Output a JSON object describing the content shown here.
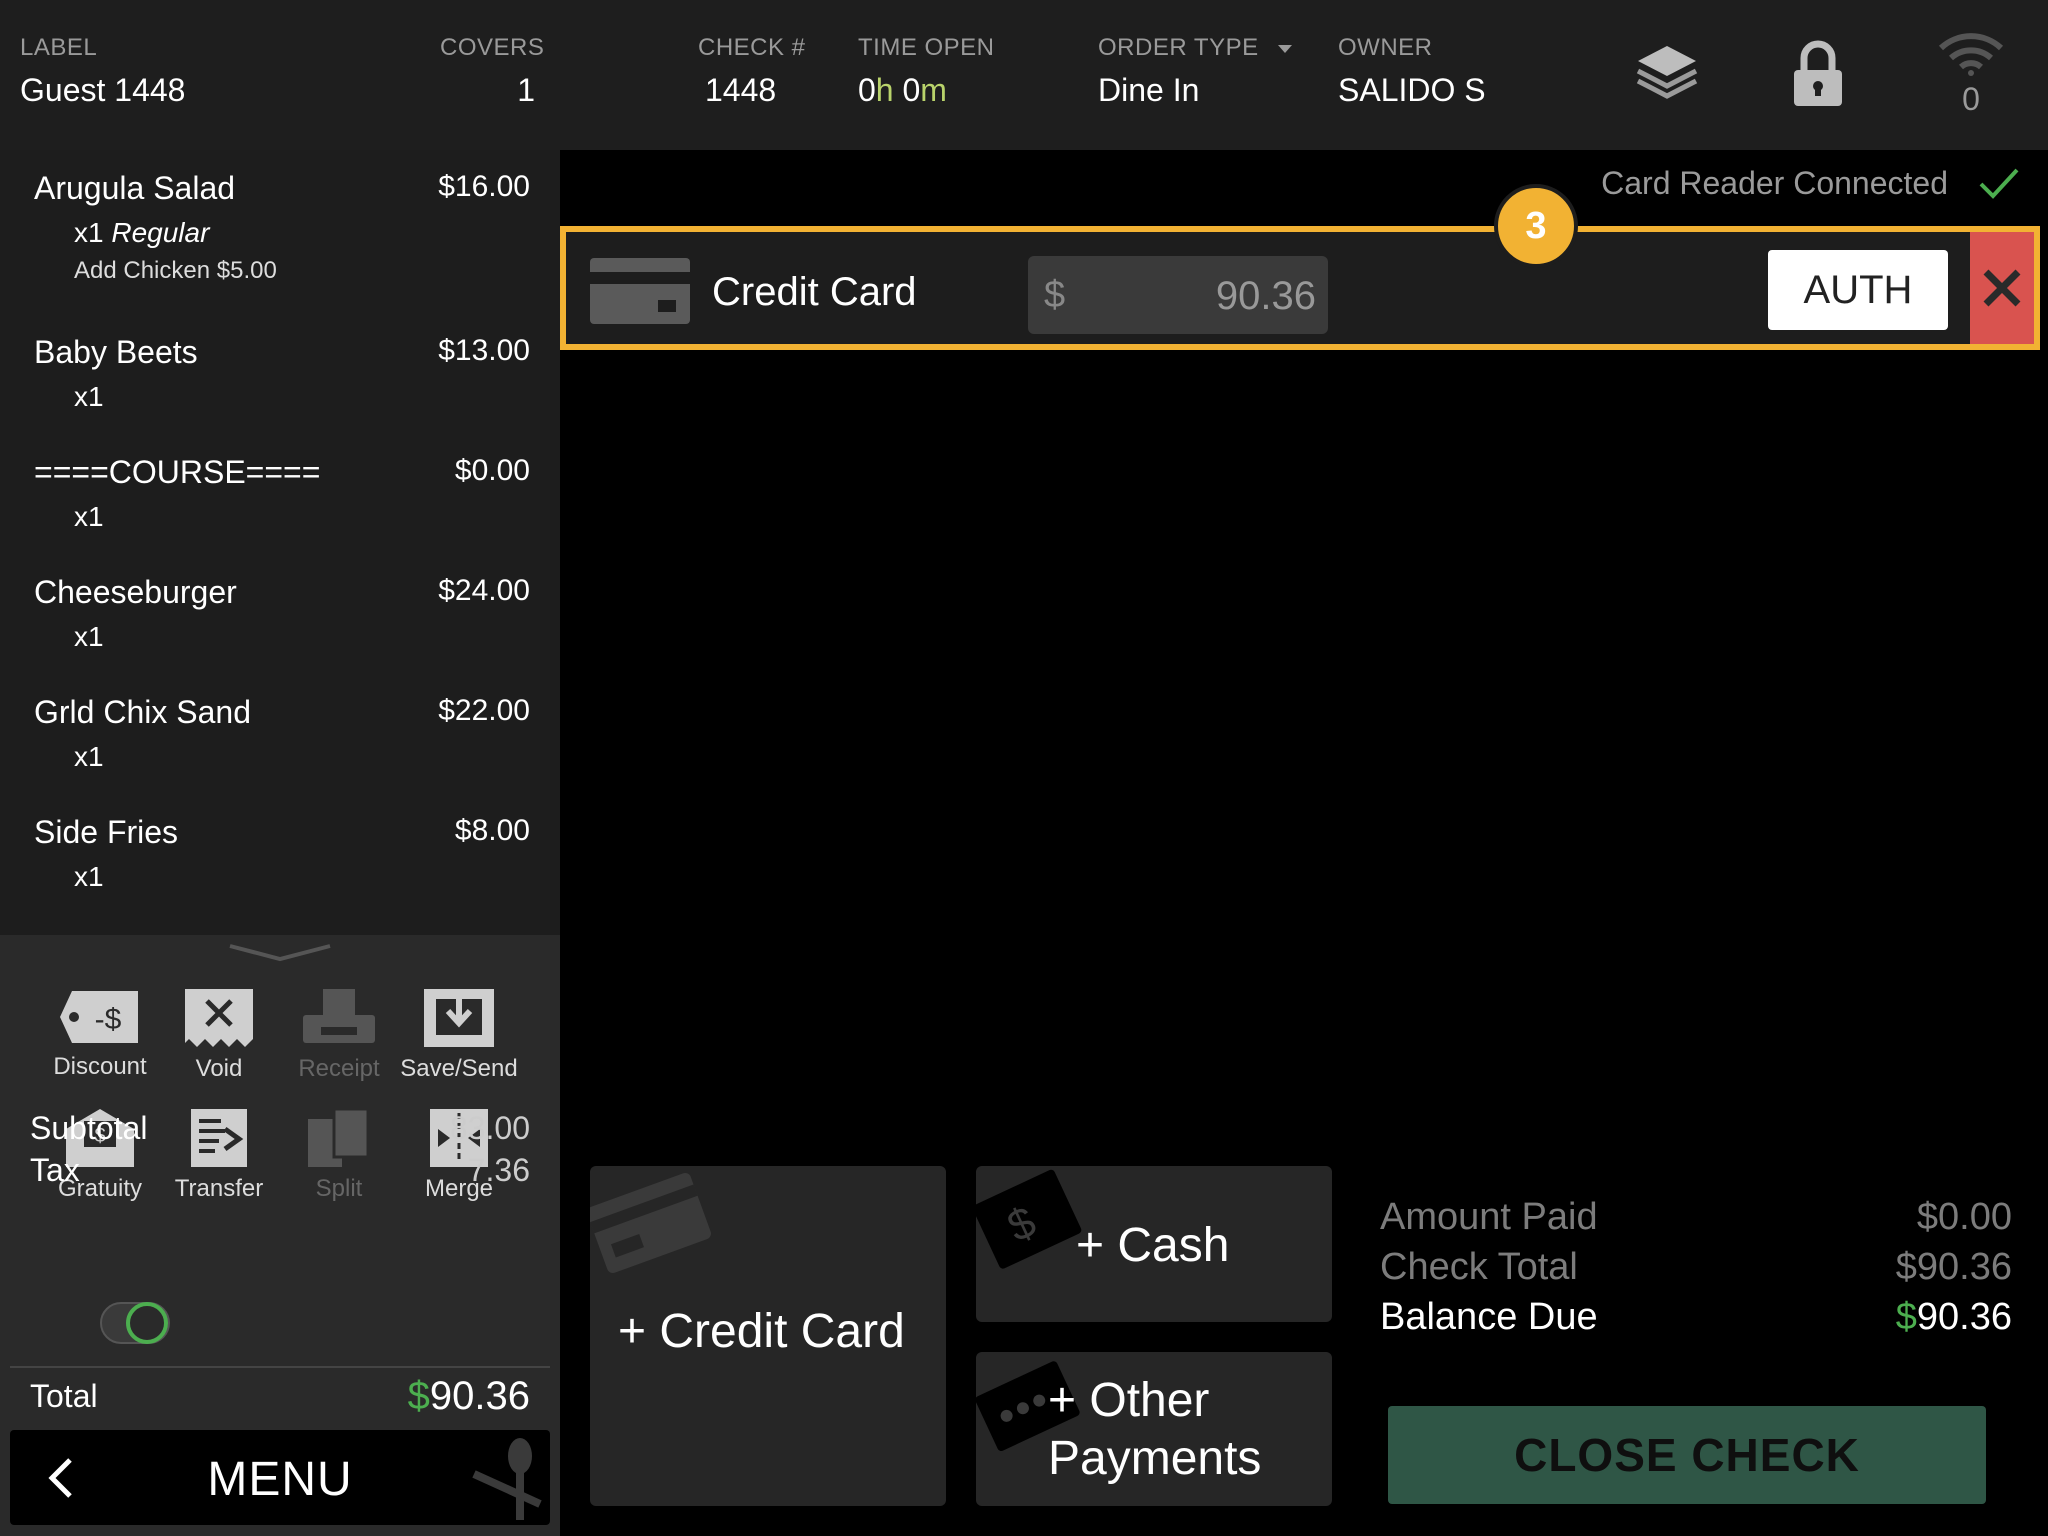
{
  "header": {
    "label_title": "LABEL",
    "label_value": "Guest 1448",
    "covers_title": "COVERS",
    "covers_value": "1",
    "check_title": "CHECK #",
    "check_value": "1448",
    "time_title": "TIME OPEN",
    "time_hours": "0",
    "time_h_unit": "h",
    "time_minutes": "0",
    "time_m_unit": "m",
    "ordertype_title": "ORDER TYPE",
    "ordertype_value": "Dine In",
    "owner_title": "OWNER",
    "owner_value": "SALIDO S",
    "wifi_count": "0",
    "icons": [
      "layers-icon",
      "lock-icon",
      "wifi-icon"
    ]
  },
  "order_items": [
    {
      "name": "Arugula Salad",
      "price": "$16.00",
      "qty": "x1",
      "variant": "Regular",
      "modifier": "Add Chicken $5.00"
    },
    {
      "name": "Baby Beets",
      "price": "$13.00",
      "qty": "x1"
    },
    {
      "name": "====COURSE====",
      "price": "$0.00",
      "qty": "x1"
    },
    {
      "name": "Cheeseburger",
      "price": "$24.00",
      "qty": "x1"
    },
    {
      "name": "Grld Chix Sand",
      "price": "$22.00",
      "qty": "x1"
    },
    {
      "name": "Side Fries",
      "price": "$8.00",
      "qty": "x1"
    }
  ],
  "actions": {
    "discount": "Discount",
    "discount_tag": "-$",
    "void": "Void",
    "receipt": "Receipt",
    "save_send": "Save/Send",
    "gratuity": "Gratuity",
    "transfer": "Transfer",
    "split": "Split",
    "merge": "Merge"
  },
  "totals": {
    "subtotal_label": "Subtotal",
    "subtotal_value": "83.00",
    "tax_label": "Tax",
    "tax_value": "7.36",
    "tax_enabled": true,
    "total_label": "Total",
    "total_currency": "$",
    "total_value": "90.36"
  },
  "menu_label": "MENU",
  "card_reader_status": "Card Reader Connected",
  "payment_line": {
    "label": "Credit Card",
    "currency": "$",
    "amount": "90.36",
    "auth_label": "AUTH",
    "step_badge": "3"
  },
  "payment_buttons": {
    "credit_card": "+ Credit Card",
    "cash": "+ Cash",
    "other_line1": "+ Other",
    "other_line2": "Payments"
  },
  "summary": {
    "amount_paid_label": "Amount Paid",
    "amount_paid_value": "$0.00",
    "check_total_label": "Check Total",
    "check_total_value": "$90.36",
    "balance_due_label": "Balance Due",
    "balance_due_currency": "$",
    "balance_due_value": "90.36"
  },
  "close_check_label": "CLOSE CHECK",
  "colors": {
    "accent_green": "#4cae4f",
    "highlight_yellow": "#f2b233",
    "delete_red": "#d9534f",
    "close_check_bg": "#2f5646"
  }
}
